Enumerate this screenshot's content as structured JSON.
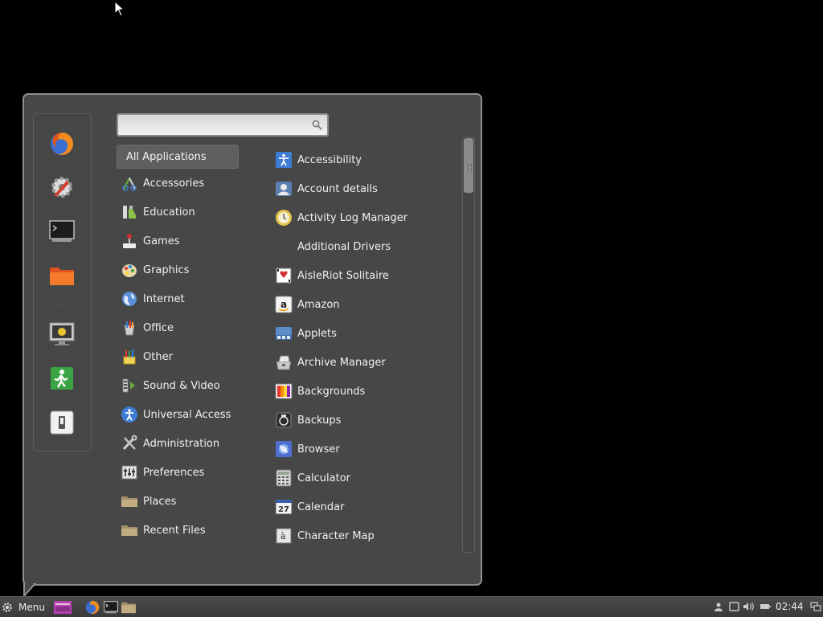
{
  "search": {
    "placeholder": "",
    "value": ""
  },
  "favorites": [
    {
      "name": "firefox",
      "icon": "firefox-icon"
    },
    {
      "name": "settings",
      "icon": "system-settings-icon"
    },
    {
      "name": "terminal",
      "icon": "terminal-icon"
    },
    {
      "name": "files",
      "icon": "folder-icon"
    },
    {
      "name": "lock-screen",
      "icon": "lock-screen-icon"
    },
    {
      "name": "logout",
      "icon": "logout-icon"
    },
    {
      "name": "shutdown",
      "icon": "power-icon"
    }
  ],
  "categories": {
    "selected": "All Applications",
    "items": [
      {
        "label": "All Applications",
        "icon": "all-apps-icon"
      },
      {
        "label": "Accessories",
        "icon": "accessories-icon"
      },
      {
        "label": "Education",
        "icon": "education-icon"
      },
      {
        "label": "Games",
        "icon": "games-icon"
      },
      {
        "label": "Graphics",
        "icon": "graphics-icon"
      },
      {
        "label": "Internet",
        "icon": "internet-icon"
      },
      {
        "label": "Office",
        "icon": "office-icon"
      },
      {
        "label": "Other",
        "icon": "other-icon"
      },
      {
        "label": "Sound & Video",
        "icon": "sound-video-icon"
      },
      {
        "label": "Universal Access",
        "icon": "universal-access-icon"
      },
      {
        "label": "Administration",
        "icon": "administration-icon"
      },
      {
        "label": "Preferences",
        "icon": "preferences-icon"
      },
      {
        "label": "Places",
        "icon": "places-folder-icon"
      },
      {
        "label": "Recent Files",
        "icon": "recent-files-folder-icon"
      }
    ]
  },
  "apps": [
    {
      "label": "Accessibility",
      "icon": "accessibility-icon"
    },
    {
      "label": "Account details",
      "icon": "account-details-icon"
    },
    {
      "label": "Activity Log Manager",
      "icon": "activity-log-icon"
    },
    {
      "label": "Additional Drivers",
      "icon": ""
    },
    {
      "label": "AisleRiot Solitaire",
      "icon": "solitaire-icon"
    },
    {
      "label": "Amazon",
      "icon": "amazon-icon"
    },
    {
      "label": "Applets",
      "icon": "applets-icon"
    },
    {
      "label": "Archive Manager",
      "icon": "archive-manager-icon"
    },
    {
      "label": "Backgrounds",
      "icon": "backgrounds-icon"
    },
    {
      "label": "Backups",
      "icon": "backups-icon"
    },
    {
      "label": "Browser",
      "icon": "browser-icon"
    },
    {
      "label": "Calculator",
      "icon": "calculator-icon"
    },
    {
      "label": "Calendar",
      "icon": "calendar-icon"
    },
    {
      "label": "Character Map",
      "icon": "character-map-icon"
    }
  ],
  "panel": {
    "menu_label": "Menu",
    "clock": "02:44",
    "tasks": [
      "workspace-switcher-icon",
      "firefox-icon",
      "terminal-icon",
      "folder-icon"
    ],
    "tray": [
      "user-icon",
      "display-icon",
      "volume-icon",
      "battery-icon",
      "network-icon"
    ]
  },
  "colors": {
    "menu_bg": "#474747",
    "menu_border": "#8e8e8e",
    "selected_category_bg": "#5f5f5f",
    "panel_bg": "#404040",
    "desktop_bg": "#000000"
  }
}
